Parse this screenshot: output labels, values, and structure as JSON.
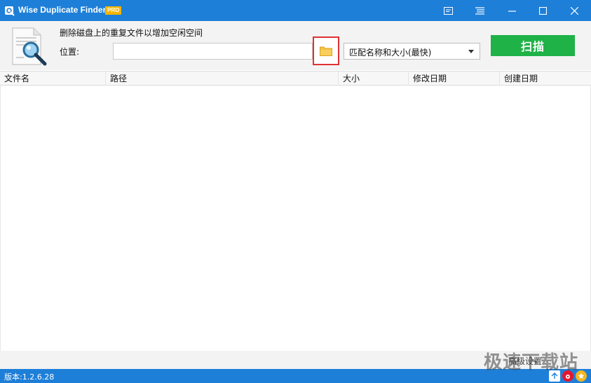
{
  "window": {
    "title": "Wise Duplicate Finder",
    "badge": "PRO"
  },
  "toolbar": {
    "subtitle": "删除磁盘上的重复文件以增加空闲空间",
    "location_label": "位置:",
    "location_value": "",
    "match_mode": "匹配名称和大小(最快)",
    "scan_label": "扫描"
  },
  "table": {
    "columns": [
      "文件名",
      "路径",
      "大小",
      "修改日期",
      "创建日期"
    ]
  },
  "footer": {
    "advanced_link": "高级设置",
    "version": "版本:1.2.6.28",
    "watermark": "极速下载站"
  },
  "colors": {
    "titlebar": "#1e7fd8",
    "scan_button": "#1fb247",
    "highlight_border": "#e03232",
    "folder_icon": "#f5c242"
  }
}
